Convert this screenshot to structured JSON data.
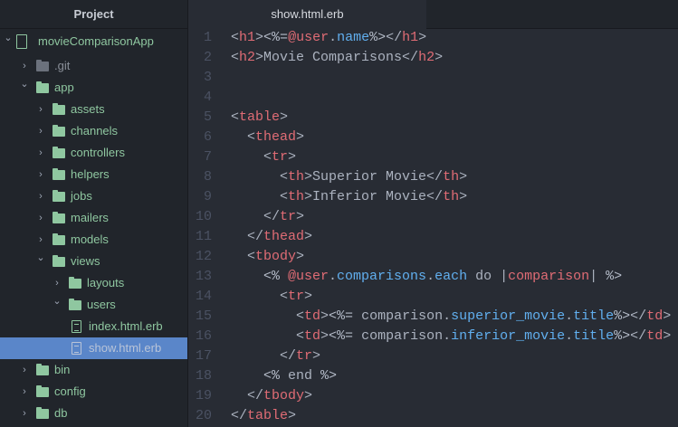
{
  "sidebar": {
    "title": "Project",
    "items": [
      {
        "label": "movieComparisonApp",
        "type": "root",
        "depth": 0,
        "open": true
      },
      {
        "label": ".git",
        "type": "folder",
        "depth": 1,
        "open": false,
        "muted": true
      },
      {
        "label": "app",
        "type": "folder",
        "depth": 1,
        "open": true
      },
      {
        "label": "assets",
        "type": "folder",
        "depth": 2,
        "open": false
      },
      {
        "label": "channels",
        "type": "folder",
        "depth": 2,
        "open": false
      },
      {
        "label": "controllers",
        "type": "folder",
        "depth": 2,
        "open": false
      },
      {
        "label": "helpers",
        "type": "folder",
        "depth": 2,
        "open": false
      },
      {
        "label": "jobs",
        "type": "folder",
        "depth": 2,
        "open": false
      },
      {
        "label": "mailers",
        "type": "folder",
        "depth": 2,
        "open": false
      },
      {
        "label": "models",
        "type": "folder",
        "depth": 2,
        "open": false
      },
      {
        "label": "views",
        "type": "folder",
        "depth": 2,
        "open": true
      },
      {
        "label": "layouts",
        "type": "folder",
        "depth": 3,
        "open": false
      },
      {
        "label": "users",
        "type": "folder",
        "depth": 3,
        "open": true
      },
      {
        "label": "index.html.erb",
        "type": "file",
        "depth": 4
      },
      {
        "label": "show.html.erb",
        "type": "file",
        "depth": 4,
        "selected": true
      },
      {
        "label": "bin",
        "type": "folder",
        "depth": 1,
        "open": false
      },
      {
        "label": "config",
        "type": "folder",
        "depth": 1,
        "open": false
      },
      {
        "label": "db",
        "type": "folder",
        "depth": 1,
        "open": false
      }
    ]
  },
  "tab": {
    "title": "show.html.erb"
  },
  "editor": {
    "lines": [
      [
        [
          "p",
          "<"
        ],
        [
          "tag",
          "h1"
        ],
        [
          "p",
          ">"
        ],
        [
          "e",
          "<%="
        ],
        [
          "tag",
          "@user"
        ],
        [
          "p",
          "."
        ],
        [
          "b",
          "name"
        ],
        [
          "e",
          "%>"
        ],
        [
          "p",
          "</"
        ],
        [
          "tag",
          "h1"
        ],
        [
          "p",
          ">"
        ]
      ],
      [
        [
          "p",
          "<"
        ],
        [
          "tag",
          "h2"
        ],
        [
          "p",
          ">Movie Comparisons</"
        ],
        [
          "tag",
          "h2"
        ],
        [
          "p",
          ">"
        ]
      ],
      [],
      [],
      [
        [
          "p",
          "<"
        ],
        [
          "tag",
          "table"
        ],
        [
          "p",
          ">"
        ]
      ],
      [
        [
          "p",
          "  <"
        ],
        [
          "tag",
          "thead"
        ],
        [
          "p",
          ">"
        ]
      ],
      [
        [
          "p",
          "    <"
        ],
        [
          "tag",
          "tr"
        ],
        [
          "p",
          ">"
        ]
      ],
      [
        [
          "p",
          "      <"
        ],
        [
          "tag",
          "th"
        ],
        [
          "p",
          ">Superior Movie</"
        ],
        [
          "tag",
          "th"
        ],
        [
          "p",
          ">"
        ]
      ],
      [
        [
          "p",
          "      <"
        ],
        [
          "tag",
          "th"
        ],
        [
          "p",
          ">Inferior Movie</"
        ],
        [
          "tag",
          "th"
        ],
        [
          "p",
          ">"
        ]
      ],
      [
        [
          "p",
          "    </"
        ],
        [
          "tag",
          "tr"
        ],
        [
          "p",
          ">"
        ]
      ],
      [
        [
          "p",
          "  </"
        ],
        [
          "tag",
          "thead"
        ],
        [
          "p",
          ">"
        ]
      ],
      [
        [
          "p",
          "  <"
        ],
        [
          "tag",
          "tbody"
        ],
        [
          "p",
          ">"
        ]
      ],
      [
        [
          "e",
          "    <% "
        ],
        [
          "tag",
          "@user"
        ],
        [
          "p",
          "."
        ],
        [
          "b",
          "comparisons"
        ],
        [
          "p",
          "."
        ],
        [
          "b",
          "each"
        ],
        [
          "p",
          " do |"
        ],
        [
          "tag",
          "comparison"
        ],
        [
          "p",
          "| "
        ],
        [
          "e",
          "%>"
        ]
      ],
      [
        [
          "p",
          "      <"
        ],
        [
          "tag",
          "tr"
        ],
        [
          "p",
          ">"
        ]
      ],
      [
        [
          "p",
          "        <"
        ],
        [
          "tag",
          "td"
        ],
        [
          "p",
          ">"
        ],
        [
          "e",
          "<%="
        ],
        [
          "p",
          " comparison."
        ],
        [
          "b",
          "superior_movie"
        ],
        [
          "p",
          "."
        ],
        [
          "b",
          "title"
        ],
        [
          "e",
          "%>"
        ],
        [
          "p",
          "</"
        ],
        [
          "tag",
          "td"
        ],
        [
          "p",
          ">"
        ]
      ],
      [
        [
          "p",
          "        <"
        ],
        [
          "tag",
          "td"
        ],
        [
          "p",
          ">"
        ],
        [
          "e",
          "<%="
        ],
        [
          "p",
          " comparison."
        ],
        [
          "b",
          "inferior_movie"
        ],
        [
          "p",
          "."
        ],
        [
          "b",
          "title"
        ],
        [
          "e",
          "%>"
        ],
        [
          "p",
          "</"
        ],
        [
          "tag",
          "td"
        ],
        [
          "p",
          ">"
        ]
      ],
      [
        [
          "p",
          "      </"
        ],
        [
          "tag",
          "tr"
        ],
        [
          "p",
          ">"
        ]
      ],
      [
        [
          "e",
          "    <% "
        ],
        [
          "p",
          "end "
        ],
        [
          "e",
          "%>"
        ]
      ],
      [
        [
          "p",
          "  </"
        ],
        [
          "tag",
          "tbody"
        ],
        [
          "p",
          ">"
        ]
      ],
      [
        [
          "p",
          "</"
        ],
        [
          "tag",
          "table"
        ],
        [
          "p",
          ">"
        ]
      ]
    ]
  }
}
